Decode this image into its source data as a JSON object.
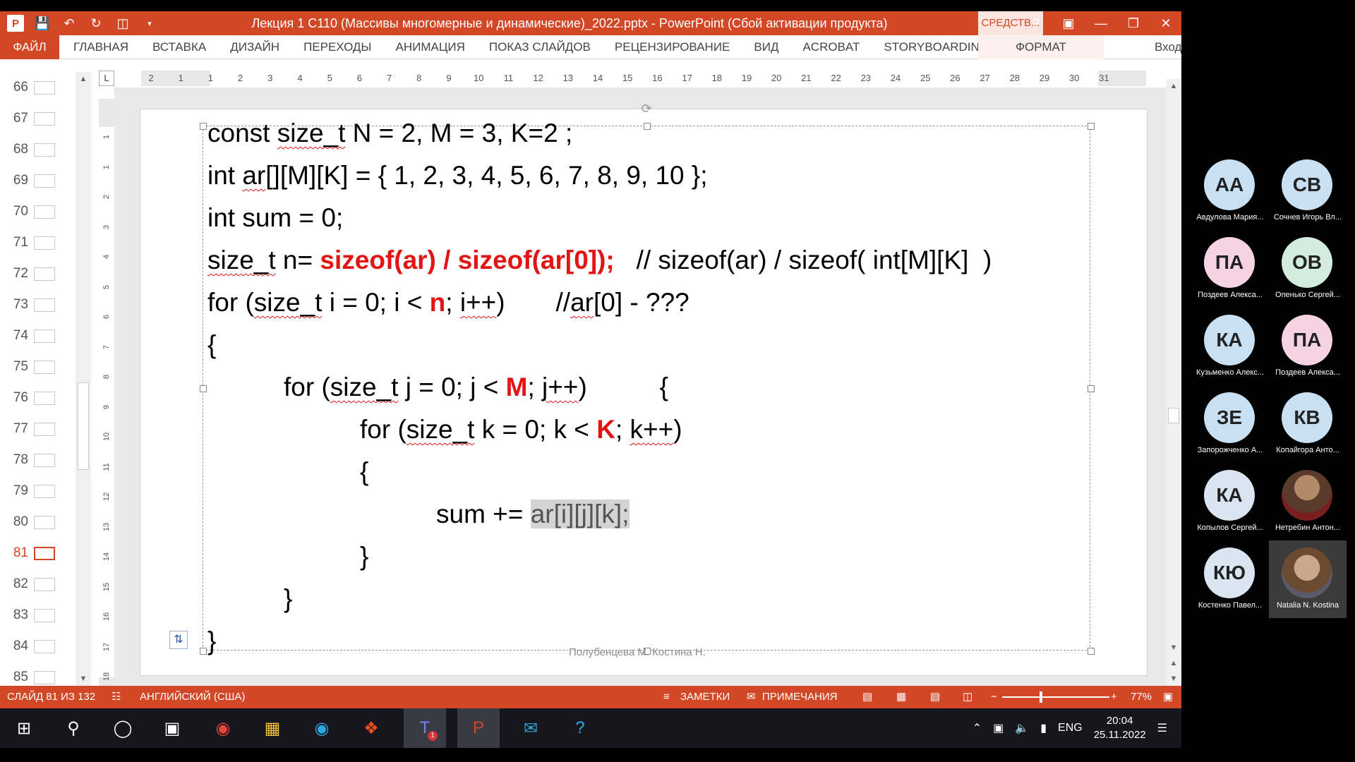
{
  "window": {
    "title": "Лекция 1 С110 (Массивы многомерные и динамические)_2022.pptx - PowerPoint (Сбой активации продукта)",
    "tools_tab": "СРЕДСТВ...",
    "help": "?"
  },
  "ribbon": {
    "file": "ФАЙЛ",
    "tabs": [
      "ГЛАВНАЯ",
      "ВСТАВКА",
      "ДИЗАЙН",
      "ПЕРЕХОДЫ",
      "АНИМАЦИЯ",
      "ПОКАЗ СЛАЙДОВ",
      "РЕЦЕНЗИРОВАНИЕ",
      "ВИД",
      "ACROBAT",
      "STORYBOARDING"
    ],
    "format": "ФОРМАТ",
    "signin": "Вход"
  },
  "thumbnails": [
    "66",
    "67",
    "68",
    "69",
    "70",
    "71",
    "72",
    "73",
    "74",
    "75",
    "76",
    "77",
    "78",
    "79",
    "80",
    "81",
    "82",
    "83",
    "84",
    "85"
  ],
  "active_slide": "81",
  "ruler": {
    "corner": "L",
    "h": [
      "2",
      "1",
      "1",
      "2",
      "3",
      "4",
      "5",
      "6",
      "7",
      "8",
      "9",
      "10",
      "11",
      "12",
      "13",
      "14",
      "15",
      "16",
      "17",
      "18",
      "19",
      "20",
      "21",
      "22",
      "23",
      "24",
      "25",
      "26",
      "27",
      "28",
      "29",
      "30",
      "31"
    ],
    "v": [
      "1",
      "1",
      "2",
      "3",
      "4",
      "5",
      "6",
      "7",
      "8",
      "9",
      "10",
      "11",
      "12",
      "13",
      "14",
      "15",
      "16",
      "17",
      "18"
    ]
  },
  "code": {
    "l1": "const size_t N = 2, M = 3, K=2 ;",
    "l2": "int ar[][M][K] = { 1, 2, 3, 4, 5, 6, 7, 8, 9, 10 };",
    "l3": "int sum = 0;",
    "l4a": "size_t n= ",
    "l4b": "sizeof(ar) / sizeof(ar[0]);",
    "l4c": "   // sizeof(ar) / sizeof( int[M][K]  )",
    "l5a": "for (size_t i = 0; i < ",
    "l5b": "n",
    "l5c": "; i++)       //ar[0] - ???",
    "l6": "{",
    "l7a": "for (size_t j = 0; j < ",
    "l7b": "M",
    "l7c": "; j++)          {",
    "l8a": "for (size_t k = 0; k < ",
    "l8b": "K",
    "l8c": "; k++)",
    "l9": "{",
    "l10a": "sum += ",
    "l10b": "ar[i][j][k];",
    "l11": "}",
    "l12": "}",
    "l13": "}"
  },
  "footer": "Полубенцева М. Костина Н.",
  "status": {
    "slide": "СЛАЙД 81 ИЗ 132",
    "lang": "АНГЛИЙСКИЙ (США)",
    "notes": "ЗАМЕТКИ",
    "comments": "ПРИМЕЧАНИЯ",
    "zoom": "77%"
  },
  "taskbar": {
    "lang": "ENG",
    "time": "20:04",
    "date": "25.11.2022",
    "teams_badge": "1"
  },
  "participants": [
    {
      "initials": "АА",
      "name": "Авдулова Мария...",
      "color": "#c9dff2"
    },
    {
      "initials": "СВ",
      "name": "Сочнев Игорь Вл...",
      "color": "#c9dff2"
    },
    {
      "initials": "ПА",
      "name": "Поздеев Алекса...",
      "color": "#f6d3e2"
    },
    {
      "initials": "ОВ",
      "name": "Опенько Сергей...",
      "color": "#d3ecdc"
    },
    {
      "initials": "КА",
      "name": "Кузьменко Алекс...",
      "color": "#c9dff2"
    },
    {
      "initials": "ПА",
      "name": "Поздеев Алекса...",
      "color": "#f6d3e2"
    },
    {
      "initials": "ЗЕ",
      "name": "Запорожченко А...",
      "color": "#c9dff2"
    },
    {
      "initials": "КВ",
      "name": "Копайгора Анто...",
      "color": "#c9dff2"
    },
    {
      "initials": "КА",
      "name": "Копылов Сергей...",
      "color": "#d9e6f2"
    },
    {
      "initials": "",
      "name": "Нетребин Антон...",
      "color": "#7a1f1f"
    },
    {
      "initials": "КЮ",
      "name": "Костенко Павел...",
      "color": "#d9e6f2"
    },
    {
      "initials": "",
      "name": "Natalia N. Kostina",
      "color": "#5a5a6a"
    }
  ]
}
